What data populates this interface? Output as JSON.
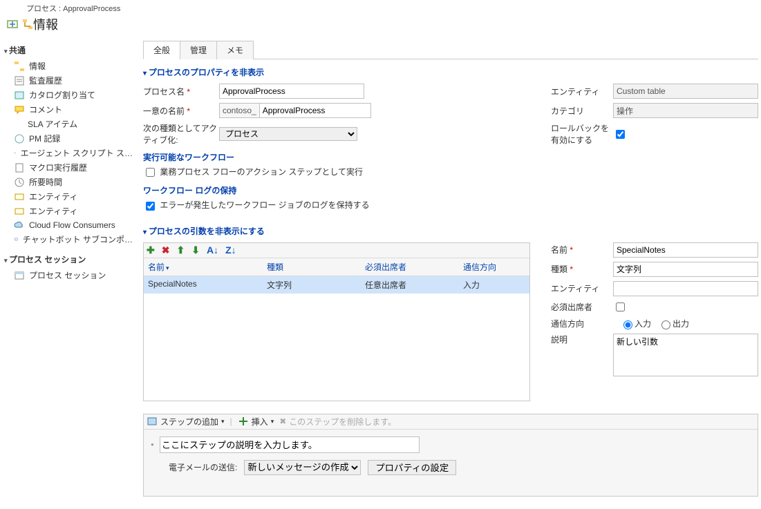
{
  "header": {
    "path": "プロセス : ApprovalProcess",
    "title": "情報"
  },
  "nav": {
    "group_common": "共通",
    "items_common": [
      "情報",
      "監査履歴",
      "カタログ割り当て",
      "コメント",
      "SLA アイテム",
      "PM 記録",
      "エージェント スクリプト ス…",
      "マクロ実行履歴",
      "所要時間",
      "エンティティ",
      "エンティティ",
      "Cloud Flow Consumers",
      "チャットボット サブコンポ…"
    ],
    "group_session": "プロセス セッション",
    "items_session": [
      "プロセス セッション"
    ]
  },
  "tabs": [
    "全般",
    "管理",
    "メモ"
  ],
  "sections": {
    "props_hidden": "プロセスのプロパティを非表示",
    "args_hidden": "プロセスの引数を非表示にする",
    "exec_wf": "実行可能なワークフロー",
    "log_retain": "ワークフロー ログの保持"
  },
  "labels": {
    "process_name": "プロセス名",
    "unique_name": "一意の名前",
    "activate_as": "次の種類としてアクティブ化:",
    "entity": "エンティティ",
    "category": "カテゴリ",
    "rollback": "ロールバックを有効にする",
    "bpf_step": "業務プロセス フローのアクション ステップとして実行",
    "log_err": "エラーが発生したワークフロー ジョブのログを保持する",
    "name": "名前",
    "type": "種類",
    "required": "必須出席者",
    "direction": "通信方向",
    "desc": "説明",
    "dir_in": "入力",
    "dir_out": "出力",
    "send_email": "電子メールの送信:",
    "prop_set": "プロパティの設定"
  },
  "values": {
    "process_name": "ApprovalProcess",
    "unique_prefix": "contoso_",
    "unique_name": "ApprovalProcess",
    "activate_as": "プロセス",
    "entity": "Custom table",
    "category": "操作",
    "arg_name": "SpecialNotes",
    "arg_type": "文字列",
    "arg_entity": "",
    "arg_desc": "新しい引数",
    "step_desc_placeholder": "ここにステップの説明を入力します。",
    "email_option": "新しいメッセージの作成"
  },
  "grid": {
    "headers": {
      "name": "名前",
      "type": "種類",
      "required": "必須出席者",
      "direction": "通信方向"
    },
    "sort_indicator": "▾",
    "rows": [
      {
        "name": "SpecialNotes",
        "type": "文字列",
        "required": "任意出席者",
        "direction": "入力"
      }
    ]
  },
  "steps_bar": {
    "add": "ステップの追加",
    "insert": "挿入",
    "delete": "このステップを削除します。"
  }
}
